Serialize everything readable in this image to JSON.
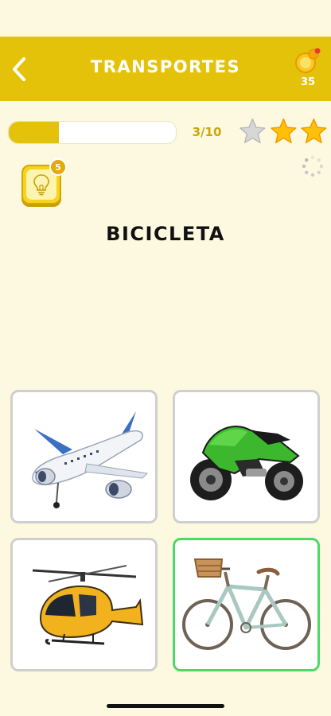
{
  "header": {
    "title": "TRANSPORTES",
    "coins": "35"
  },
  "progress": {
    "text": "3/10",
    "fraction": 0.3
  },
  "stars": {
    "filled": 2,
    "total": 3
  },
  "hint": {
    "badge": "5"
  },
  "question": {
    "word": "BICICLETA"
  },
  "options": [
    {
      "icon": "airplane-icon",
      "state": "default"
    },
    {
      "icon": "motorcycle-icon",
      "state": "default"
    },
    {
      "icon": "helicopter-icon",
      "state": "default"
    },
    {
      "icon": "bicycle-icon",
      "state": "correct"
    }
  ],
  "colors": {
    "accent": "#e5c20a",
    "background": "#fdf9e1",
    "correct": "#4cd964"
  }
}
